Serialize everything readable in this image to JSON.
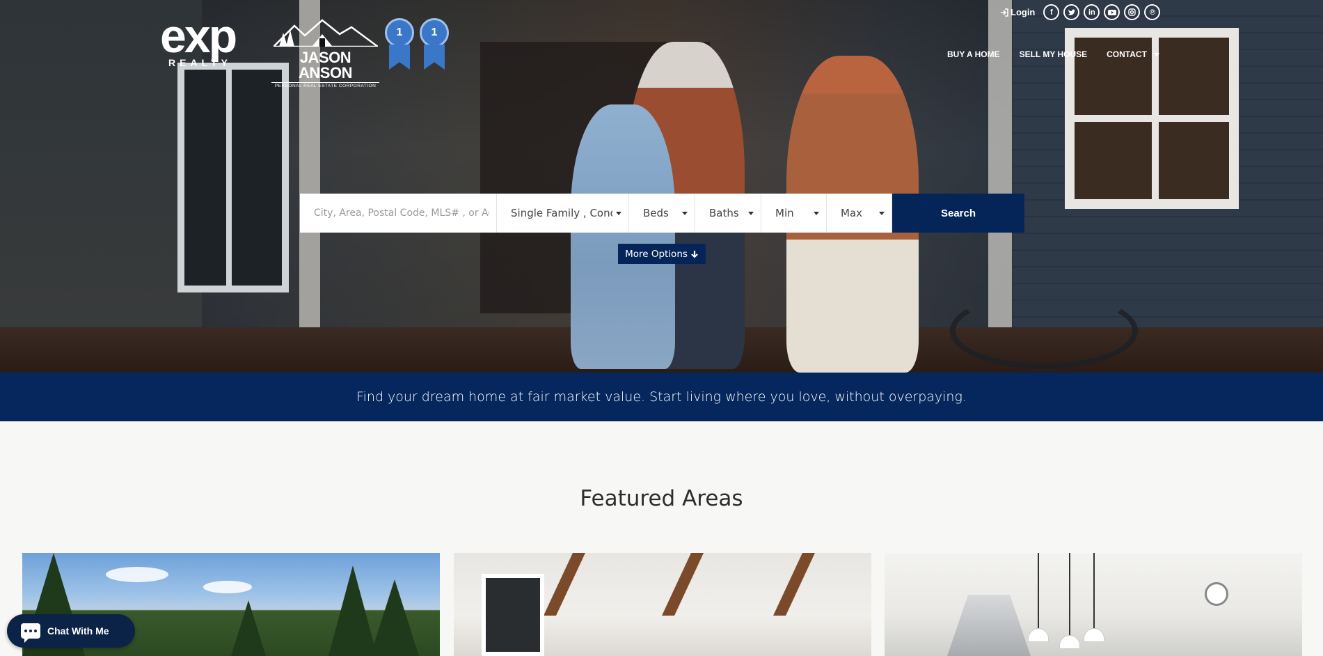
{
  "header": {
    "logo_exp": "exp",
    "logo_realty": "REALTY",
    "logo_agent_name": "JASON ANSON",
    "logo_agent_sub": "PERSONAL REAL ESTATE CORPORATION",
    "ribbons": [
      "1",
      "1"
    ],
    "login_label": "Login",
    "social_icons": [
      "facebook-icon",
      "twitter-icon",
      "linkedin-icon",
      "youtube-icon",
      "instagram-icon",
      "pinterest-icon"
    ],
    "nav": {
      "buy": "BUY A HOME",
      "sell": "SELL MY HOUSE",
      "contact": "CONTACT"
    }
  },
  "search": {
    "location_placeholder": "City, Area, Postal Code, MLS# , or Address",
    "property_type": "Single Family , Condo",
    "beds": "Beds",
    "baths": "Baths",
    "min": "Min",
    "max": "Max",
    "submit_label": "Search",
    "more_options": "More Options"
  },
  "tagline": "Find your dream home at fair market value. Start living where you love, without overpaying.",
  "featured": {
    "title": "Featured Areas"
  },
  "chat": {
    "label": "Chat With Me"
  },
  "colors": {
    "navy": "#052559",
    "band": "#05275d",
    "page_bg": "#f7f7f5"
  }
}
